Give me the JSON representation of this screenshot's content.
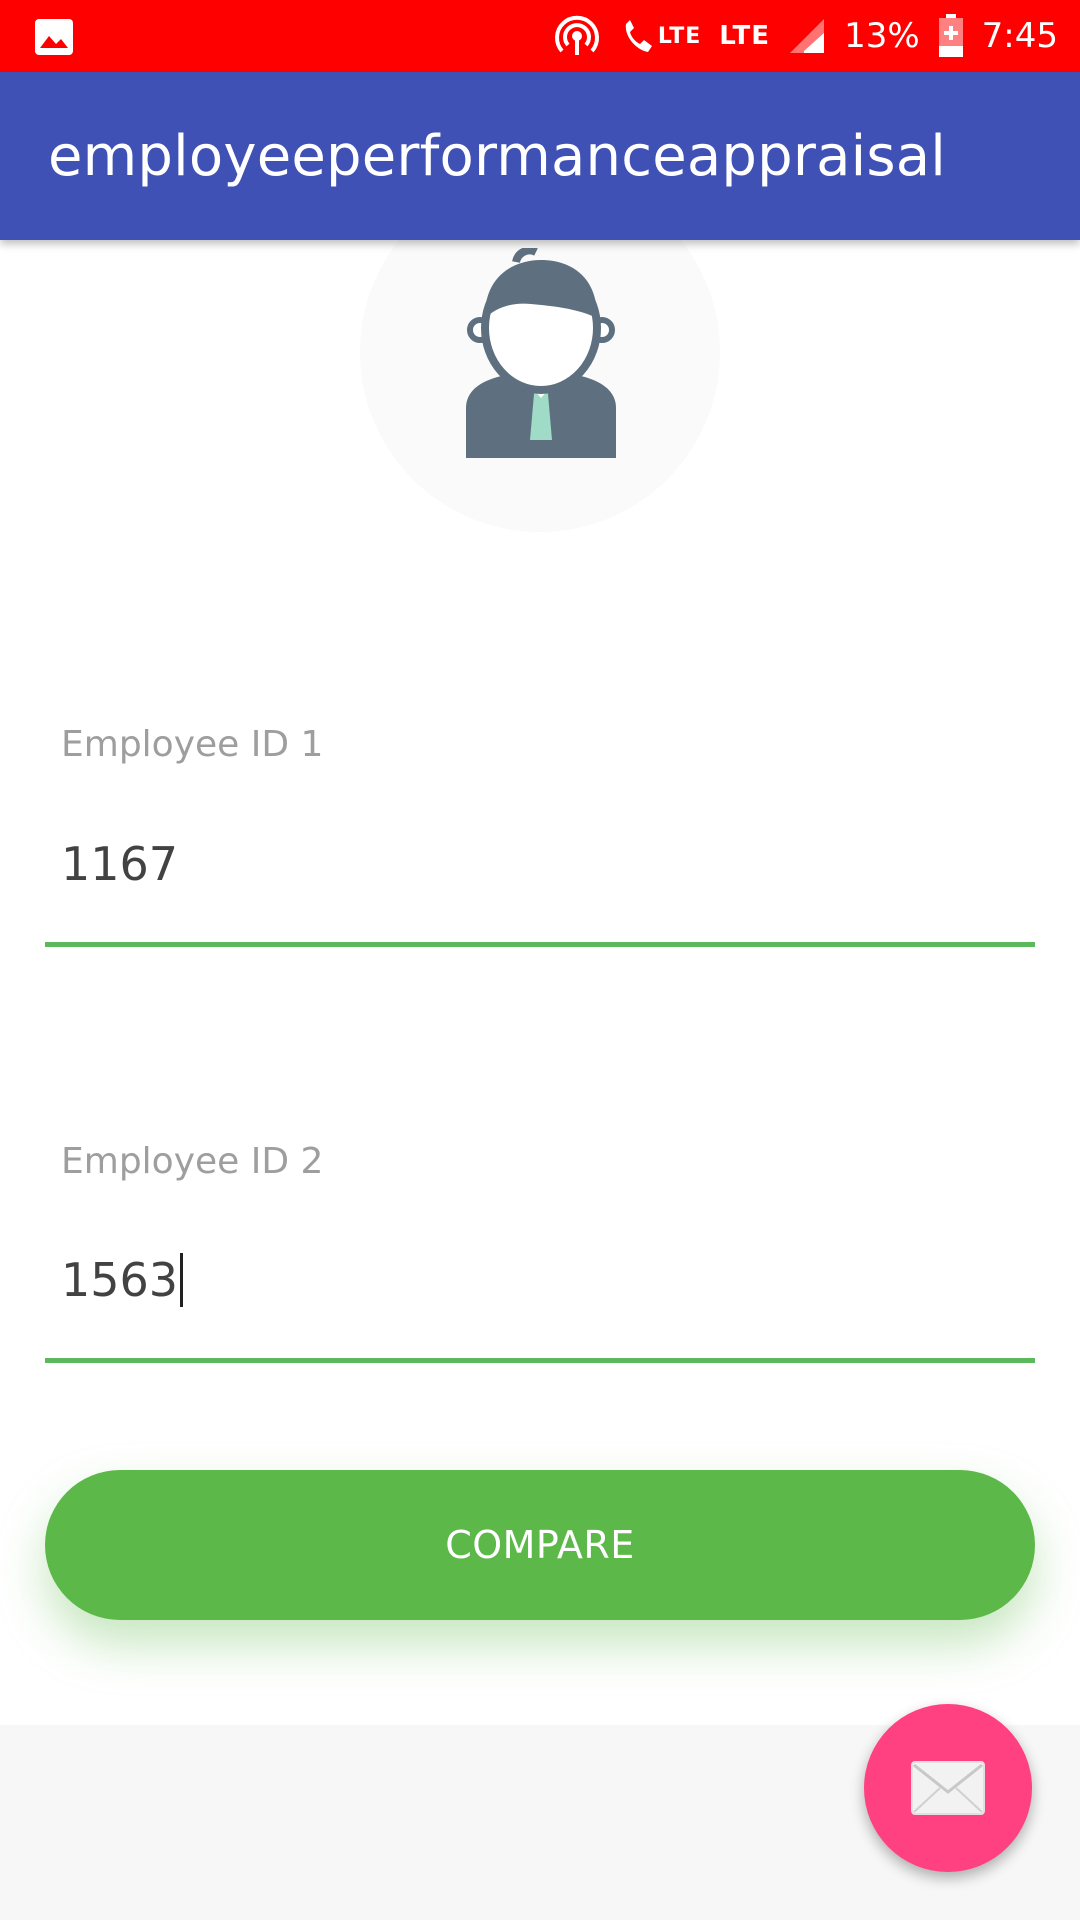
{
  "status_bar": {
    "network_label_1": "LTE",
    "network_label_2": "LTE",
    "battery": "13%",
    "time": "7:45",
    "icons": [
      "image-icon",
      "hotspot-icon",
      "phone-lte-icon",
      "signal-icon",
      "battery-icon"
    ]
  },
  "app_bar": {
    "title": "employeeperformanceappraisal"
  },
  "form": {
    "field1": {
      "label": "Employee ID 1",
      "value": "1167"
    },
    "field2": {
      "label": "Employee ID 2",
      "value": "1563"
    },
    "compare_label": "COMPARE"
  },
  "fab": {
    "icon": "mail-icon"
  },
  "colors": {
    "status_bar": "#ff0000",
    "app_bar": "#3f51b5",
    "accent_green": "#5cb848",
    "fab": "#ff4081"
  }
}
